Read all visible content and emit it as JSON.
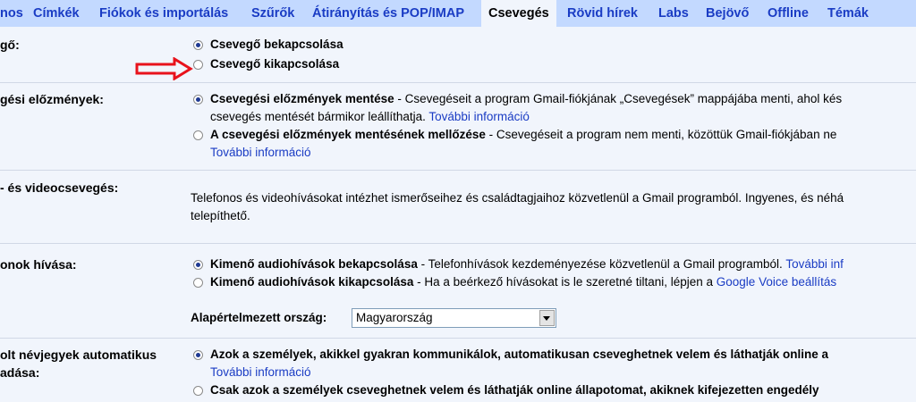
{
  "tabs": [
    {
      "label": "nos"
    },
    {
      "label": "Címkék"
    },
    {
      "label": "Fiókok és importálás"
    },
    {
      "label": "Szűrők"
    },
    {
      "label": "Átirányítás és POP/IMAP"
    },
    {
      "label": "Csevegés",
      "active": true
    },
    {
      "label": "Rövid hírek"
    },
    {
      "label": "Labs"
    },
    {
      "label": "Bejövő"
    },
    {
      "label": "Offline"
    },
    {
      "label": "Témák"
    }
  ],
  "section_chat": {
    "label": "gő:",
    "on": {
      "label": "Csevegő bekapcsolása",
      "checked": true
    },
    "off": {
      "label": "Csevegő kikapcsolása",
      "checked": false
    }
  },
  "section_history": {
    "label": "gési előzmények:",
    "save": {
      "bold": "Csevegési előzmények mentése",
      "desc": " - Csevegéseit a program Gmail-fiókjának „Csevegések” mappájába menti, ahol kés",
      "desc2": "csevegés mentését bármikor leállíthatja. ",
      "link": "További információ",
      "checked": true
    },
    "nosave": {
      "bold": "A csevegési előzmények mentésének mellőzése",
      "desc": " - Csevegéseit a program nem menti, közöttük Gmail-fiókjában ne",
      "link": "További információ",
      "checked": false
    }
  },
  "section_video": {
    "label": "- és videocsevegés:",
    "line1": "Telefonos és videohívásokat intézhet ismerőseihez és családtagjaihoz közvetlenül a Gmail programból. Ingyenes, és néhá",
    "line2": "telepíthető."
  },
  "section_calls": {
    "label": "onok hívása:",
    "on": {
      "bold": "Kimenő audiohívások bekapcsolása",
      "desc": " - Telefonhívások kezdeményezése közvetlenül a Gmail programból. ",
      "link": "További inf",
      "checked": true
    },
    "off": {
      "bold": "Kimenő audiohívások kikapcsolása",
      "desc": " - Ha a beérkező hívásokat is le szeretné tiltani, lépjen a ",
      "link": "Google Voice beállítás",
      "checked": false
    },
    "country_label": "Alapértelmezett ország:",
    "country_value": "Magyarország"
  },
  "section_contacts": {
    "label1": "olt névjegyek automatikus",
    "label2": "adása:",
    "opt1": {
      "bold": "Azok a személyek, akikkel gyakran kommunikálok, automatikusan cseveghetnek velem és láthatják online a",
      "link": "További információ",
      "checked": true
    },
    "opt2": {
      "bold": "Csak azok a személyek cseveghetnek velem és láthatják online állapotomat, akiknek kifejezetten engedély",
      "checked": false
    }
  },
  "colors": {
    "tab_bar": "#c3d9ff",
    "page_bg": "#f1f5fc",
    "link": "#1a3cc4",
    "arrow": "#e8121b"
  }
}
